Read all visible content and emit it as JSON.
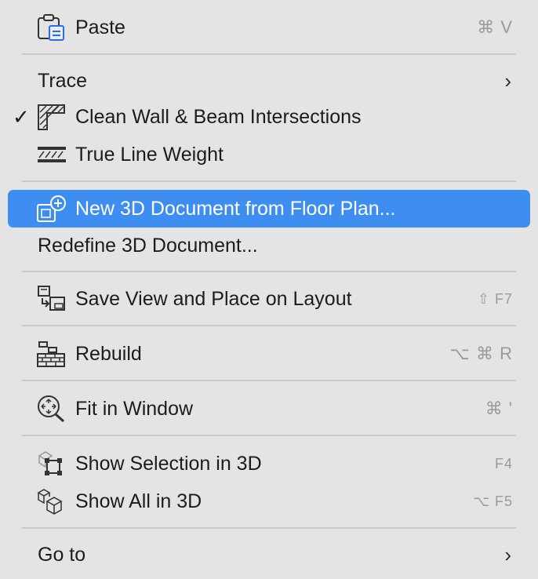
{
  "menu": {
    "items": [
      {
        "label": "Paste",
        "shortcut": "⌘ V",
        "icon": "paste-clipboard-icon"
      },
      {
        "label": "Trace",
        "submenu": true
      },
      {
        "label": "Clean Wall & Beam Intersections",
        "checked": true,
        "check_mark": "✓",
        "icon": "wall-intersection-icon"
      },
      {
        "label": "True Line Weight",
        "icon": "line-weight-icon"
      },
      {
        "label": "New 3D Document from Floor Plan...",
        "highlighted": true,
        "icon": "new-3d-document-icon"
      },
      {
        "label": "Redefine 3D Document..."
      },
      {
        "label": "Save View and Place on Layout",
        "shortcut": "⇧ F7",
        "icon": "save-view-layout-icon"
      },
      {
        "label": "Rebuild",
        "shortcut": "⌥ ⌘ R",
        "icon": "rebuild-icon"
      },
      {
        "label": "Fit in Window",
        "shortcut": "⌘ '",
        "icon": "fit-in-window-icon"
      },
      {
        "label": "Show Selection in 3D",
        "shortcut": "F4",
        "icon": "show-selection-3d-icon"
      },
      {
        "label": "Show All in 3D",
        "shortcut": "⌥ F5",
        "icon": "show-all-3d-icon"
      },
      {
        "label": "Go to",
        "submenu": true
      }
    ],
    "chevron": "›"
  },
  "colors": {
    "highlight": "#3d8ef0",
    "background": "#e4e4e4",
    "shortcut": "#9a9a9a"
  }
}
